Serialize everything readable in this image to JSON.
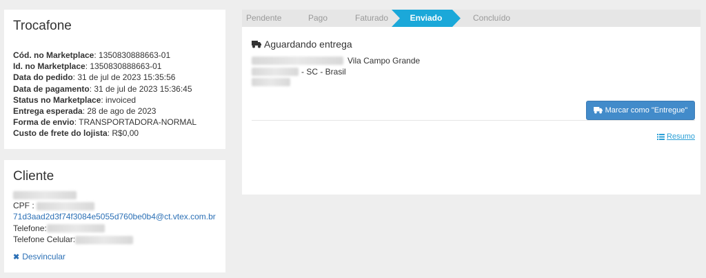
{
  "order": {
    "title": "Trocafone",
    "rows": [
      {
        "label": "Cód. no Marketplace",
        "value": ": 1350830888663-01"
      },
      {
        "label": "Id. no Marketplace",
        "value": ": 1350830888663-01"
      },
      {
        "label": "Data do pedido",
        "value": ": 31 de jul de 2023 15:35:56"
      },
      {
        "label": "Data de pagamento",
        "value": ": 31 de jul de 2023 15:36:45"
      },
      {
        "label": "Status no Marketplace",
        "value": ": invoiced"
      },
      {
        "label": "Entrega esperada",
        "value": ": 28 de ago de 2023"
      },
      {
        "label": "Forma de envio",
        "value": ": TRANSPORTADORA-NORMAL"
      },
      {
        "label": "Custo de frete do lojista",
        "value": ": R$0,00"
      }
    ]
  },
  "client": {
    "title": "Cliente",
    "cpf_label": "CPF :",
    "email": "71d3aad2d3f74f3084e5055d760be0b4@ct.vtex.com.br",
    "phone_label": "Telefone:",
    "mobile_label": "Telefone Celular:",
    "unlink_label": "Desvincular"
  },
  "status_steps": {
    "pendente": "Pendente",
    "pago": "Pago",
    "faturado": "Faturado",
    "enviado": "Enviado",
    "concluido": "Concluído",
    "active_color": "#1ba8d9"
  },
  "delivery": {
    "title": "Aguardando entrega",
    "address_line1_visible": "Vila Campo Grande",
    "address_line2_visible": "- SC - Brasil",
    "mark_button": "Marcar como \"Entregue\"",
    "resumo_link": "Resumo"
  },
  "colors": {
    "accent": "#1ba8d9",
    "button": "#428bca",
    "link": "#2a6fb5"
  }
}
